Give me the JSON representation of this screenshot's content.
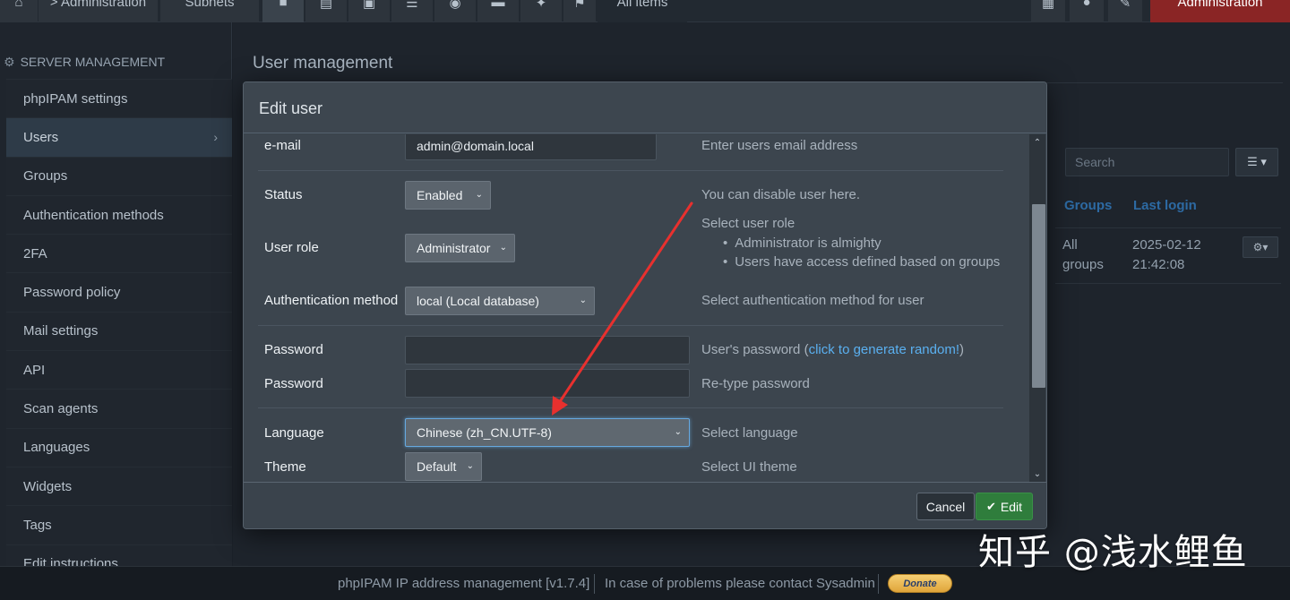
{
  "topbar": {
    "breadcrumb": "> Administration",
    "subnets_label": "Subnets",
    "all_items_label": "All items",
    "admin_label": "Administration"
  },
  "sidebar": {
    "section_title": "SERVER MANAGEMENT",
    "items": [
      {
        "label": "phpIPAM settings"
      },
      {
        "label": "Users",
        "active": true
      },
      {
        "label": "Groups"
      },
      {
        "label": "Authentication methods"
      },
      {
        "label": "2FA"
      },
      {
        "label": "Password policy"
      },
      {
        "label": "Mail settings"
      },
      {
        "label": "API"
      },
      {
        "label": "Scan agents"
      },
      {
        "label": "Languages"
      },
      {
        "label": "Widgets"
      },
      {
        "label": "Tags"
      },
      {
        "label": "Edit instructions"
      }
    ]
  },
  "main": {
    "title": "User management",
    "search_placeholder": "Search",
    "columns": {
      "groups": "Groups",
      "last_login": "Last login"
    },
    "row": {
      "groups_line1": "All",
      "groups_line2": "groups",
      "last_login_line1": "2025-02-12",
      "last_login_line2": "21:42:08"
    }
  },
  "modal": {
    "title": "Edit user",
    "fields": {
      "email": {
        "label": "e-mail",
        "value": "admin@domain.local",
        "hint": "Enter users email address"
      },
      "status": {
        "label": "Status",
        "value": "Enabled",
        "hint": "You can disable user here."
      },
      "role": {
        "label": "User role",
        "value": "Administrator",
        "hint": "Select user role",
        "bullets": [
          "Administrator is almighty",
          "Users have access defined based on groups"
        ]
      },
      "auth": {
        "label": "Authentication method",
        "value": "local (Local database)",
        "hint": "Select authentication method for user"
      },
      "password1": {
        "label": "Password",
        "value": "",
        "hint_prefix": "User's password (",
        "hint_link": "click to generate random!",
        "hint_suffix": ")"
      },
      "password2": {
        "label": "Password",
        "value": "",
        "hint": "Re-type password"
      },
      "language": {
        "label": "Language",
        "value": "Chinese (zh_CN.UTF-8)",
        "hint": "Select language"
      },
      "theme": {
        "label": "Theme",
        "value": "Default",
        "hint": "Select UI theme"
      }
    },
    "buttons": {
      "cancel": "Cancel",
      "edit": "Edit"
    }
  },
  "footer": {
    "app_name": "phpIPAM IP address management [v1.7.4]",
    "contact": "In case of problems please contact Sysadmin",
    "donate": "Donate"
  },
  "watermark": "知乎 @浅水鲤鱼",
  "colors": {
    "accent_link": "#5ab0f0",
    "annotation_arrow": "#e8302e",
    "admin_button": "#8a2525",
    "edit_button": "#2f7d3c"
  }
}
